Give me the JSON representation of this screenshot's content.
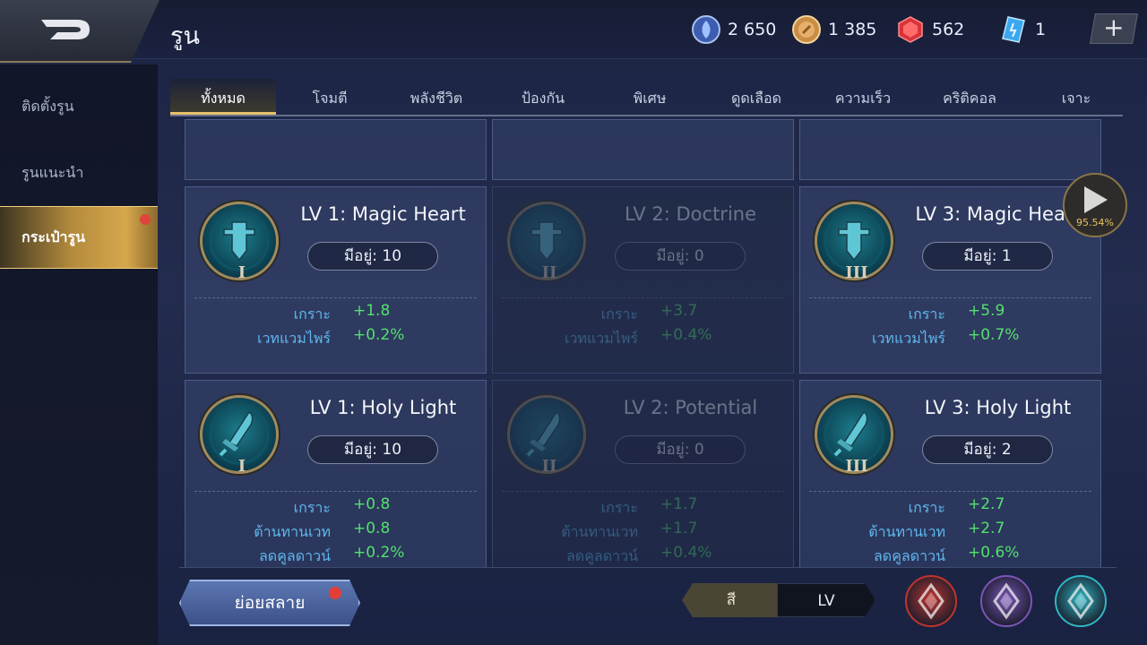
{
  "header": {
    "title": "รูน",
    "currencies": [
      {
        "name": "blue-coin",
        "value": "2 650"
      },
      {
        "name": "gold-coin",
        "value": "1 385"
      },
      {
        "name": "red-gem",
        "value": "562"
      },
      {
        "name": "blue-card",
        "value": "1"
      }
    ],
    "plus_label": "+"
  },
  "sidebar": {
    "items": [
      {
        "label": "ติดตั้งรูน"
      },
      {
        "label": "รูนแนะนำ"
      },
      {
        "label": "กระเป๋ารูน",
        "active": true
      }
    ]
  },
  "tabs": [
    {
      "label": "ทั้งหมด",
      "active": true
    },
    {
      "label": "โจมตี"
    },
    {
      "label": "พลังชีวิต"
    },
    {
      "label": "ป้องกัน"
    },
    {
      "label": "พิเศษ"
    },
    {
      "label": "ดูดเลือด"
    },
    {
      "label": "ความเร็ว"
    },
    {
      "label": "คริติคอล"
    },
    {
      "label": "เจาะ"
    }
  ],
  "cards": [
    {
      "title": "LV 1: Magic Heart",
      "roman": "I",
      "owned": "มีอยู่: 10",
      "dim": false,
      "icon": "sword-emblem-icon",
      "stats": [
        {
          "name": "เกราะ",
          "value": "+1.8"
        },
        {
          "name": "เวทแวมไพร์",
          "value": "+0.2%"
        }
      ]
    },
    {
      "title": "LV 2: Doctrine",
      "roman": "II",
      "owned": "มีอยู่: 0",
      "dim": true,
      "icon": "sword-emblem-icon",
      "stats": [
        {
          "name": "เกราะ",
          "value": "+3.7"
        },
        {
          "name": "เวทแวมไพร์",
          "value": "+0.4%"
        }
      ]
    },
    {
      "title": "LV 3: Magic Heart",
      "roman": "III",
      "owned": "มีอยู่: 1",
      "dim": false,
      "icon": "sword-emblem-icon",
      "stats": [
        {
          "name": "เกราะ",
          "value": "+5.9"
        },
        {
          "name": "เวทแวมไพร์",
          "value": "+0.7%"
        }
      ]
    },
    {
      "title": "LV 1: Holy Light",
      "roman": "I",
      "owned": "มีอยู่: 10",
      "dim": false,
      "icon": "blade-emblem-icon",
      "stats": [
        {
          "name": "เกราะ",
          "value": "+0.8"
        },
        {
          "name": "ต้านทานเวท",
          "value": "+0.8"
        },
        {
          "name": "ลดคูลดาวน์",
          "value": "+0.2%"
        }
      ]
    },
    {
      "title": "LV 2: Potential",
      "roman": "II",
      "owned": "มีอยู่: 0",
      "dim": true,
      "icon": "blade-emblem-icon",
      "stats": [
        {
          "name": "เกราะ",
          "value": "+1.7"
        },
        {
          "name": "ต้านทานเวท",
          "value": "+1.7"
        },
        {
          "name": "ลดคูลดาวน์",
          "value": "+0.4%"
        }
      ]
    },
    {
      "title": "LV 3: Holy Light",
      "roman": "III",
      "owned": "มีอยู่: 2",
      "dim": false,
      "icon": "blade-emblem-icon",
      "stats": [
        {
          "name": "เกราะ",
          "value": "+2.7"
        },
        {
          "name": "ต้านทานเวท",
          "value": "+2.7"
        },
        {
          "name": "ลดคูลดาวน์",
          "value": "+0.6%"
        }
      ]
    }
  ],
  "next_button": {
    "percent": "95.54%"
  },
  "footer": {
    "salvage_label": "ย่อยสลาย",
    "sort_toggle": [
      {
        "label": "สี",
        "active": true
      },
      {
        "label": "LV",
        "active": false
      }
    ],
    "filter_gems": [
      {
        "name": "red-rune-filter-icon",
        "color": "#c0342f"
      },
      {
        "name": "purple-rune-filter-icon",
        "color": "#7b55b8"
      },
      {
        "name": "teal-rune-filter-icon",
        "color": "#2fb7c4"
      }
    ]
  }
}
